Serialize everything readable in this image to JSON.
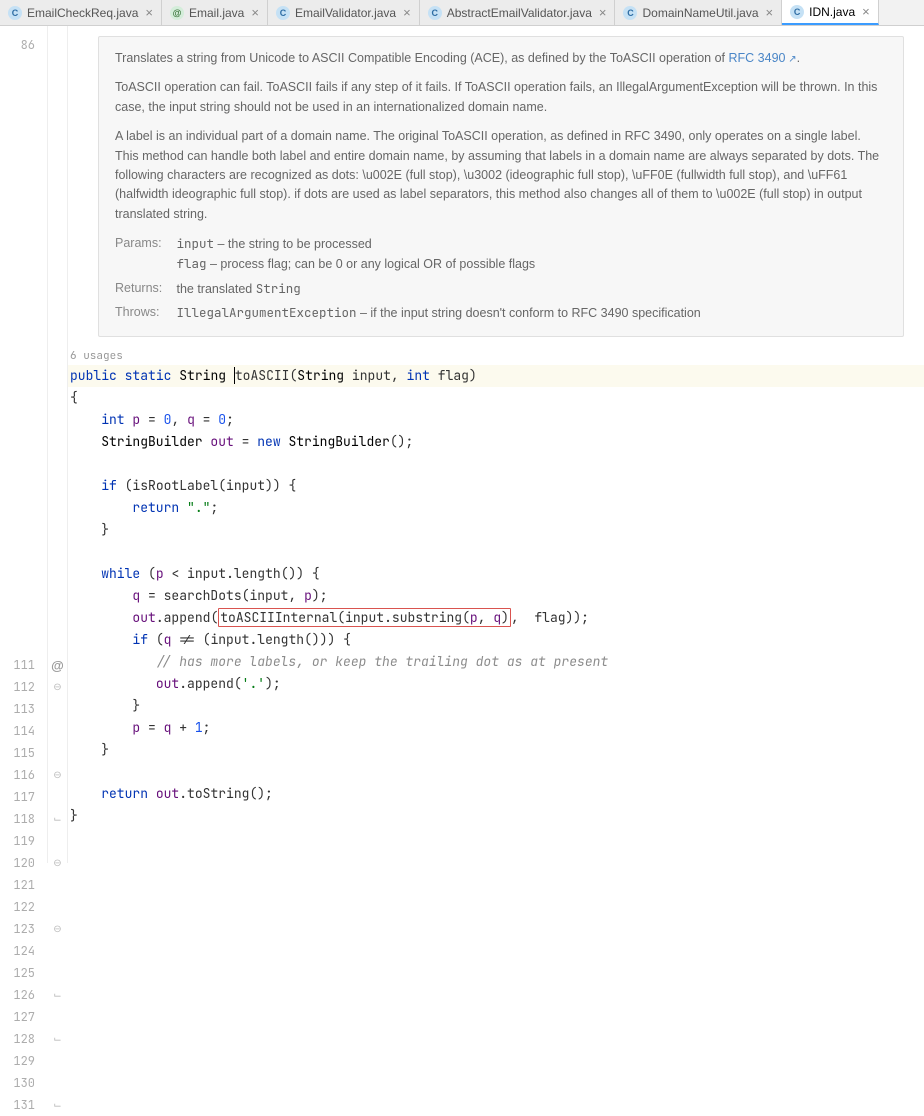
{
  "tabs": [
    {
      "label": "EmailCheckReq.java",
      "icon": "C",
      "active": false
    },
    {
      "label": "Email.java",
      "icon": "@",
      "active": false
    },
    {
      "label": "EmailValidator.java",
      "icon": "C",
      "active": false
    },
    {
      "label": "AbstractEmailValidator.java",
      "icon": "C",
      "active": false
    },
    {
      "label": "DomainNameUtil.java",
      "icon": "C",
      "active": false
    },
    {
      "label": "IDN.java",
      "icon": "C",
      "active": true
    }
  ],
  "lineNumbers": [
    "86",
    "",
    "",
    "",
    "",
    "",
    "",
    "",
    "",
    "",
    "",
    "",
    "",
    "",
    "",
    "111",
    "112",
    "113",
    "114",
    "115",
    "116",
    "117",
    "118",
    "119",
    "120",
    "121",
    "122",
    "123",
    "124",
    "125",
    "126",
    "127",
    "128",
    "129",
    "130",
    "131"
  ],
  "usagesLabel": "6 usages",
  "doc": {
    "p1a": "Translates a string from Unicode to ASCII Compatible Encoding (ACE), as defined by the ToASCII operation of ",
    "rfcLink": "RFC 3490",
    "p1b": ".",
    "p2": "ToASCII operation can fail. ToASCII fails if any step of it fails. If ToASCII operation fails, an IllegalArgumentException will be thrown. In this case, the input string should not be used in an internationalized domain name.",
    "p3": "A label is an individual part of a domain name. The original ToASCII operation, as defined in RFC 3490, only operates on a single label. This method can handle both label and entire domain name, by assuming that labels in a domain name are always separated by dots. The following characters are recognized as dots: \\u002E (full stop), \\u3002 (ideographic full stop), \\uFF0E (fullwidth full stop), and \\uFF61 (halfwidth ideographic full stop). if dots are used as label separators, this method also changes all of them to \\u002E (full stop) in output translated string.",
    "paramsLabel": "Params:",
    "param1name": "input",
    "param1desc": " – the string to be processed",
    "param2name": "flag",
    "param2desc": " – process flag; can be 0 or any logical OR of possible flags",
    "returnsLabel": "Returns:",
    "returnsDescA": "the translated ",
    "returnsDescB": "String",
    "throwsLabel": "Throws:",
    "throwsType": "IllegalArgumentException",
    "throwsDesc": " – if the input string doesn't conform to RFC 3490 specification"
  },
  "code": {
    "kw_public": "public",
    "kw_static": "static",
    "kw_int": "int",
    "kw_new": "new",
    "kw_if": "if",
    "kw_return": "return",
    "kw_while": "while",
    "ty_String": "String",
    "ty_StringBuilder": "StringBuilder",
    "fn_toASCII": "toASCII",
    "fn_isRootLabel": "isRootLabel",
    "fn_length": "length",
    "fn_searchDots": "searchDots",
    "fn_append": "append",
    "fn_toASCIIInternal": "toASCIIInternal",
    "fn_substring": "substring",
    "fn_toString": "toString",
    "var_input": "input",
    "var_flag": "flag",
    "var_p": "p",
    "var_q": "q",
    "var_out": "out",
    "num_0": "0",
    "num_1": "1",
    "str_dot": "\".\"",
    "str_dotchar": "'.'",
    "comment": "// has more labels, or keep the trailing dot as at present"
  }
}
